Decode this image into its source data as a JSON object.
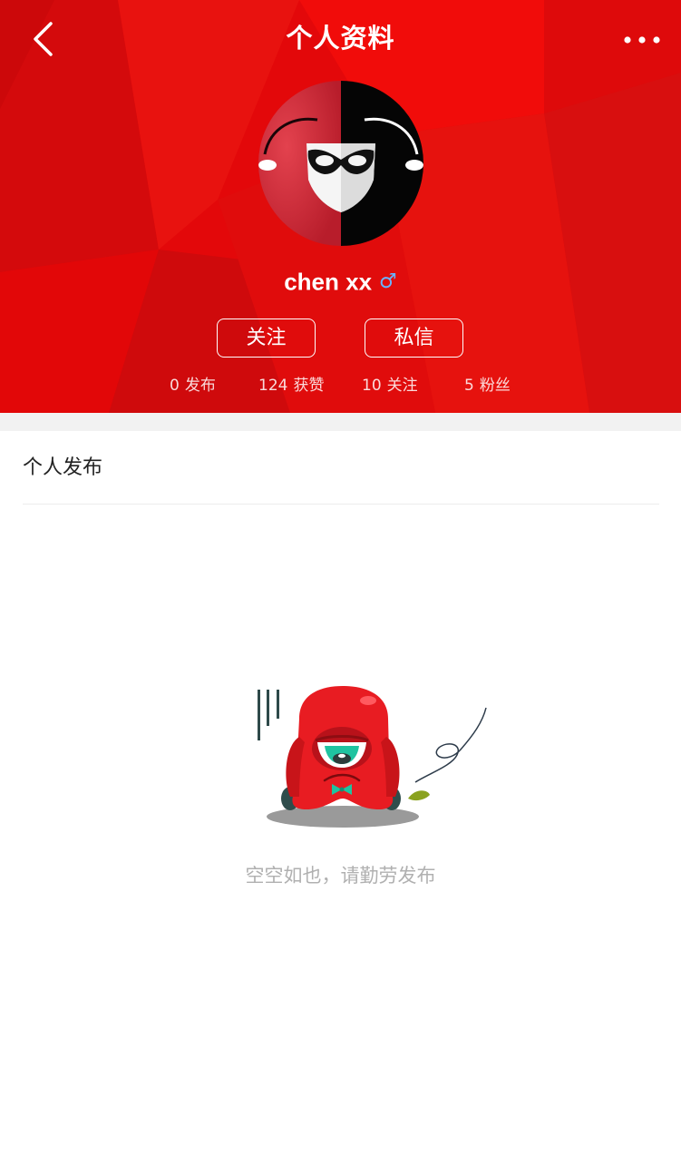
{
  "nav": {
    "title": "个人资料",
    "back_icon": "chevron-left-icon",
    "more_icon": "more-dots-icon"
  },
  "profile": {
    "avatar": "masked-cartoon-avatar",
    "username": "chen xx",
    "gender_symbol": "♂",
    "gender_icon": "male-icon"
  },
  "actions": {
    "follow_label": "关注",
    "message_label": "私信"
  },
  "stats": [
    {
      "count": "0",
      "label": "发布"
    },
    {
      "count": "124",
      "label": "获赞"
    },
    {
      "count": "10",
      "label": "关注"
    },
    {
      "count": "5",
      "label": "粉丝"
    }
  ],
  "section": {
    "title": "个人发布"
  },
  "empty_state": {
    "illustration": "sad-red-monster-illustration",
    "message": "空空如也，请勤劳发布"
  },
  "colors": {
    "brand_red": "#e3080a",
    "gender_blue": "#69b3ff",
    "muted_text": "#b0b0b0"
  }
}
